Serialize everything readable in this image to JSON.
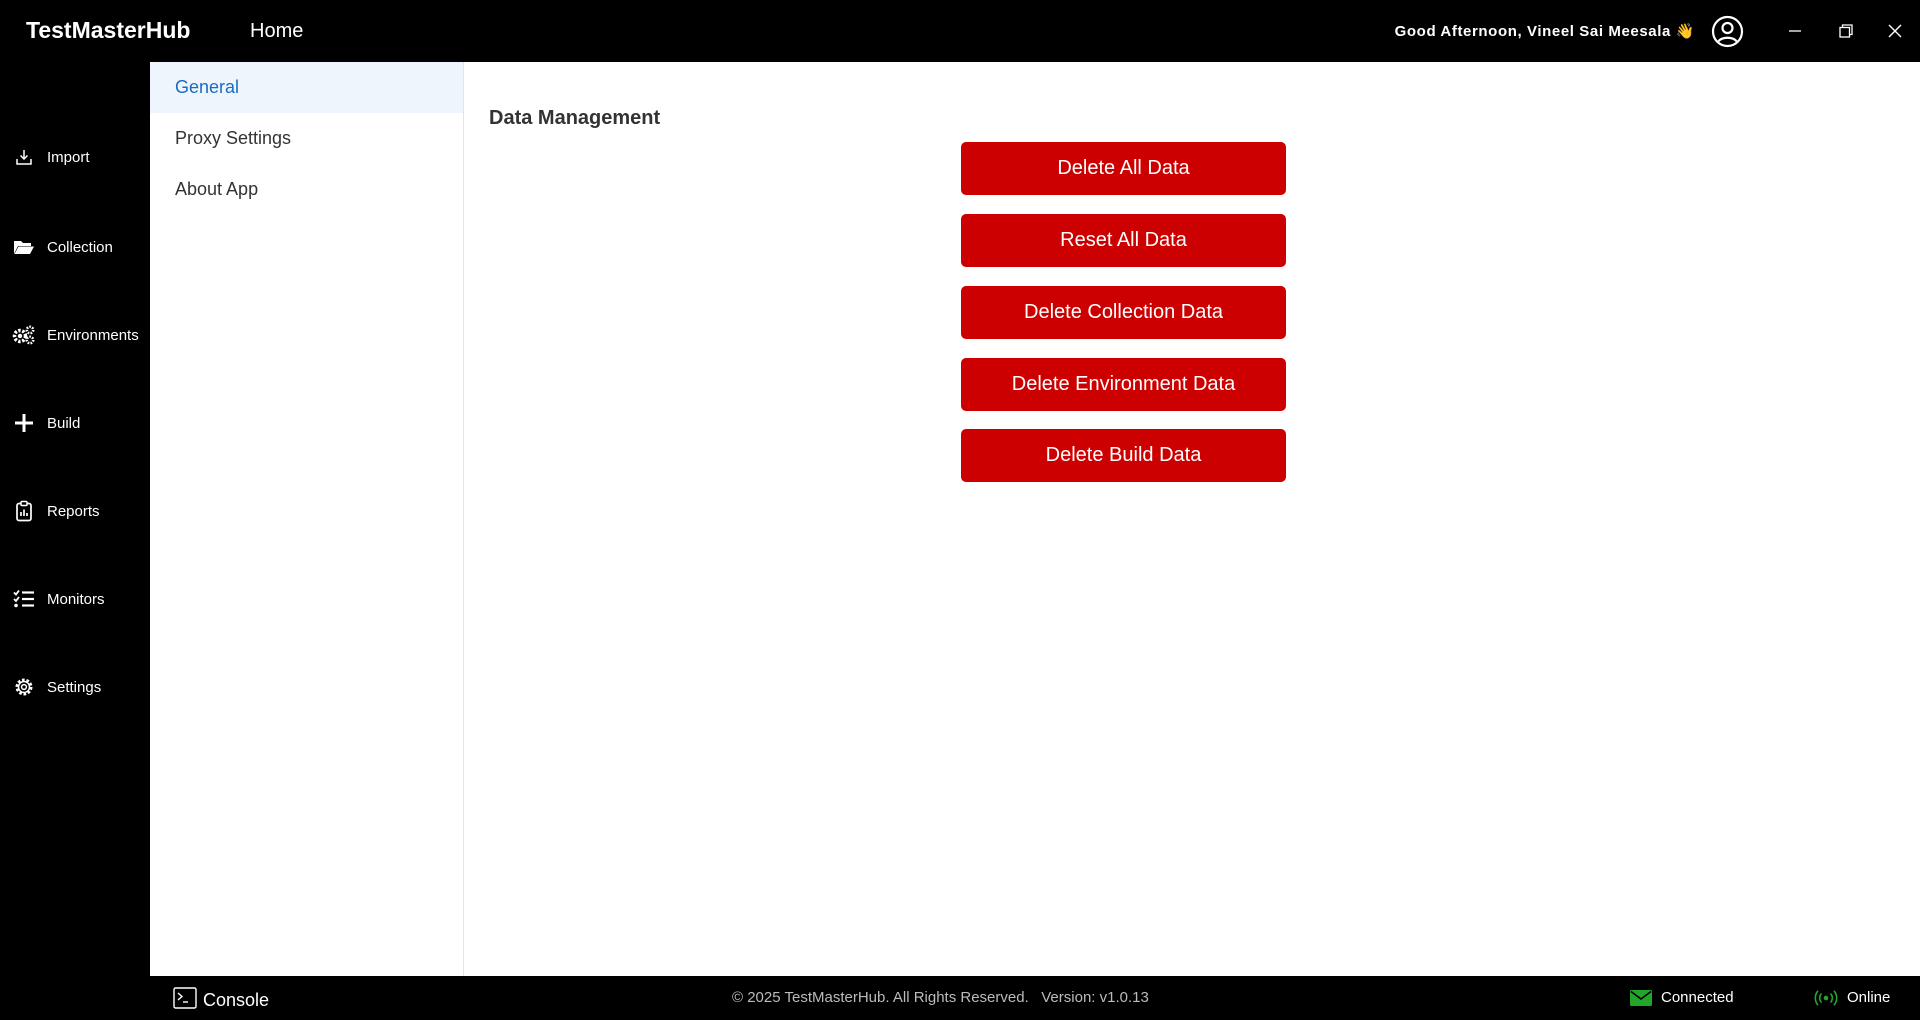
{
  "header": {
    "brand": "TestMasterHub",
    "home_label": "Home",
    "greeting": "Good Afternoon, Vineel Sai Meesala 👋"
  },
  "sidebar": {
    "items": [
      {
        "label": "Import",
        "icon": "import-icon"
      },
      {
        "label": "Collection",
        "icon": "folder-open-icon"
      },
      {
        "label": "Environments",
        "icon": "gears-icon"
      },
      {
        "label": "Build",
        "icon": "plus-icon"
      },
      {
        "label": "Reports",
        "icon": "clipboard-chart-icon"
      },
      {
        "label": "Monitors",
        "icon": "list-check-icon"
      },
      {
        "label": "Settings",
        "icon": "gear-icon"
      }
    ]
  },
  "settings_nav": {
    "items": [
      {
        "label": "General",
        "active": true
      },
      {
        "label": "Proxy Settings",
        "active": false
      },
      {
        "label": "About App",
        "active": false
      }
    ]
  },
  "main": {
    "section_title": "Data Management",
    "buttons": [
      "Delete All Data",
      "Reset All Data",
      "Delete Collection Data",
      "Delete Environment Data",
      "Delete Build Data"
    ]
  },
  "footer": {
    "console_label": "Console",
    "copyright": "© 2025 TestMasterHub. All Rights Reserved.   Version: v1.0.13",
    "connection_status": "Connected",
    "network_status": "Online"
  },
  "colors": {
    "danger": "#cc0000",
    "active_link": "#1a6bc4",
    "active_bg": "#eef5fc",
    "status_green": "#22a52b"
  }
}
